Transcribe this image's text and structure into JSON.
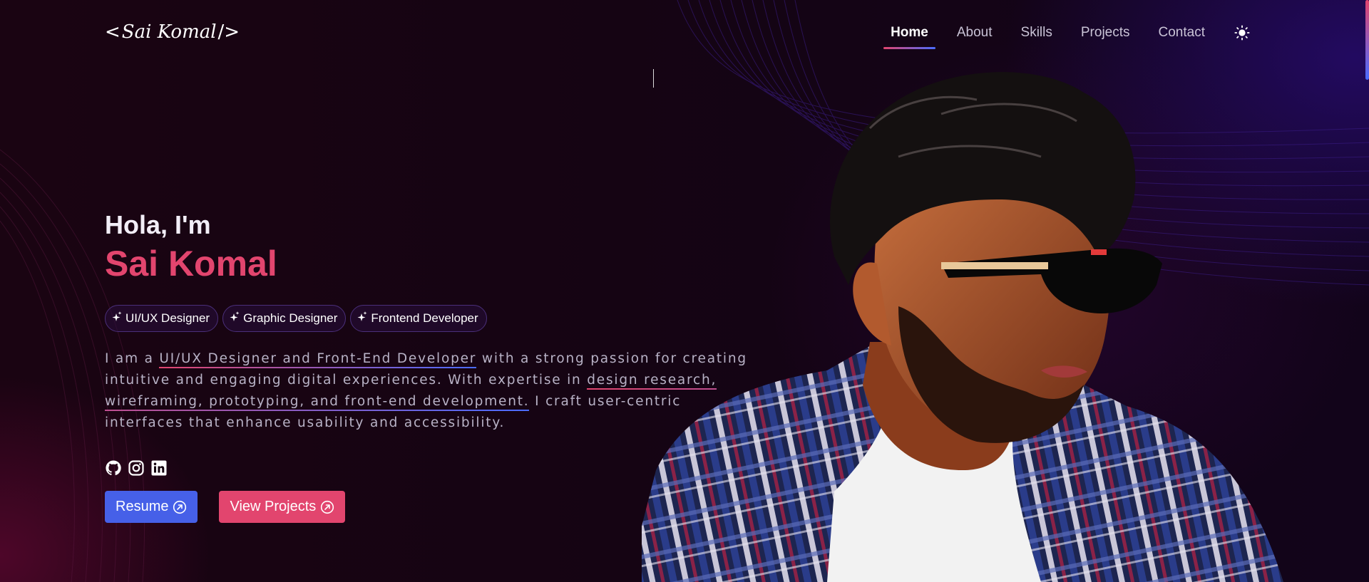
{
  "logo": {
    "open": "<",
    "text": "Sai Komal",
    "close": "/>"
  },
  "nav": {
    "items": [
      {
        "label": "Home",
        "active": true
      },
      {
        "label": "About"
      },
      {
        "label": "Skills"
      },
      {
        "label": "Projects"
      },
      {
        "label": "Contact"
      }
    ],
    "theme_icon": "sun-icon"
  },
  "hero": {
    "greeting": "Hola, I'm",
    "name": "Sai Komal",
    "roles": [
      "UI/UX Designer",
      "Graphic Designer",
      "Frontend Developer"
    ],
    "role_icon": "sparkle-icon",
    "bio": {
      "p1": "I am a ",
      "h1": "UI/UX Designer and Front-End Developer",
      "p2": " with a strong passion for creating intuitive and engaging digital experiences. With expertise in ",
      "h2": "design research, wireframing, prototyping, and front-end development.",
      "p3": " I craft user-centric interfaces that enhance usability and accessibility."
    },
    "social": [
      "github-icon",
      "instagram-icon",
      "linkedin-icon"
    ],
    "buttons": {
      "resume": "Resume",
      "projects": "View Projects"
    }
  },
  "colors": {
    "accent": "#e2456e",
    "primary": "#4660e8",
    "background": "#12030f"
  }
}
